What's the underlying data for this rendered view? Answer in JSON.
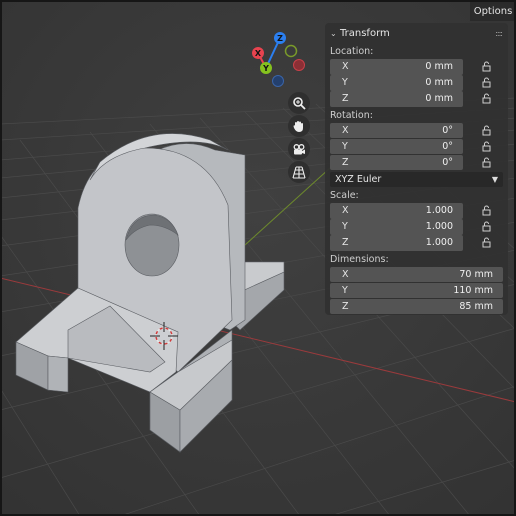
{
  "header": {
    "options_label": "Options"
  },
  "gizmo": {
    "axes": [
      {
        "label": "Z",
        "color": "#2b7ff0"
      },
      {
        "label": "X",
        "color": "#e8434f"
      },
      {
        "label": "Y",
        "color": "#85c21e"
      }
    ]
  },
  "nav_icons": [
    "zoom-icon",
    "hand-icon",
    "camera-icon",
    "grid-icon"
  ],
  "transform": {
    "title": "Transform",
    "location_label": "Location:",
    "location": [
      {
        "axis": "X",
        "value": "0 mm"
      },
      {
        "axis": "Y",
        "value": "0 mm"
      },
      {
        "axis": "Z",
        "value": "0 mm"
      }
    ],
    "rotation_label": "Rotation:",
    "rotation": [
      {
        "axis": "X",
        "value": "0°"
      },
      {
        "axis": "Y",
        "value": "0°"
      },
      {
        "axis": "Z",
        "value": "0°"
      }
    ],
    "rotation_mode": "XYZ Euler",
    "scale_label": "Scale:",
    "scale": [
      {
        "axis": "X",
        "value": "1.000"
      },
      {
        "axis": "Y",
        "value": "1.000"
      },
      {
        "axis": "Z",
        "value": "1.000"
      }
    ],
    "dimensions_label": "Dimensions:",
    "dimensions": [
      {
        "axis": "X",
        "value": "70 mm"
      },
      {
        "axis": "Y",
        "value": "110 mm"
      },
      {
        "axis": "Z",
        "value": "85 mm"
      }
    ]
  }
}
